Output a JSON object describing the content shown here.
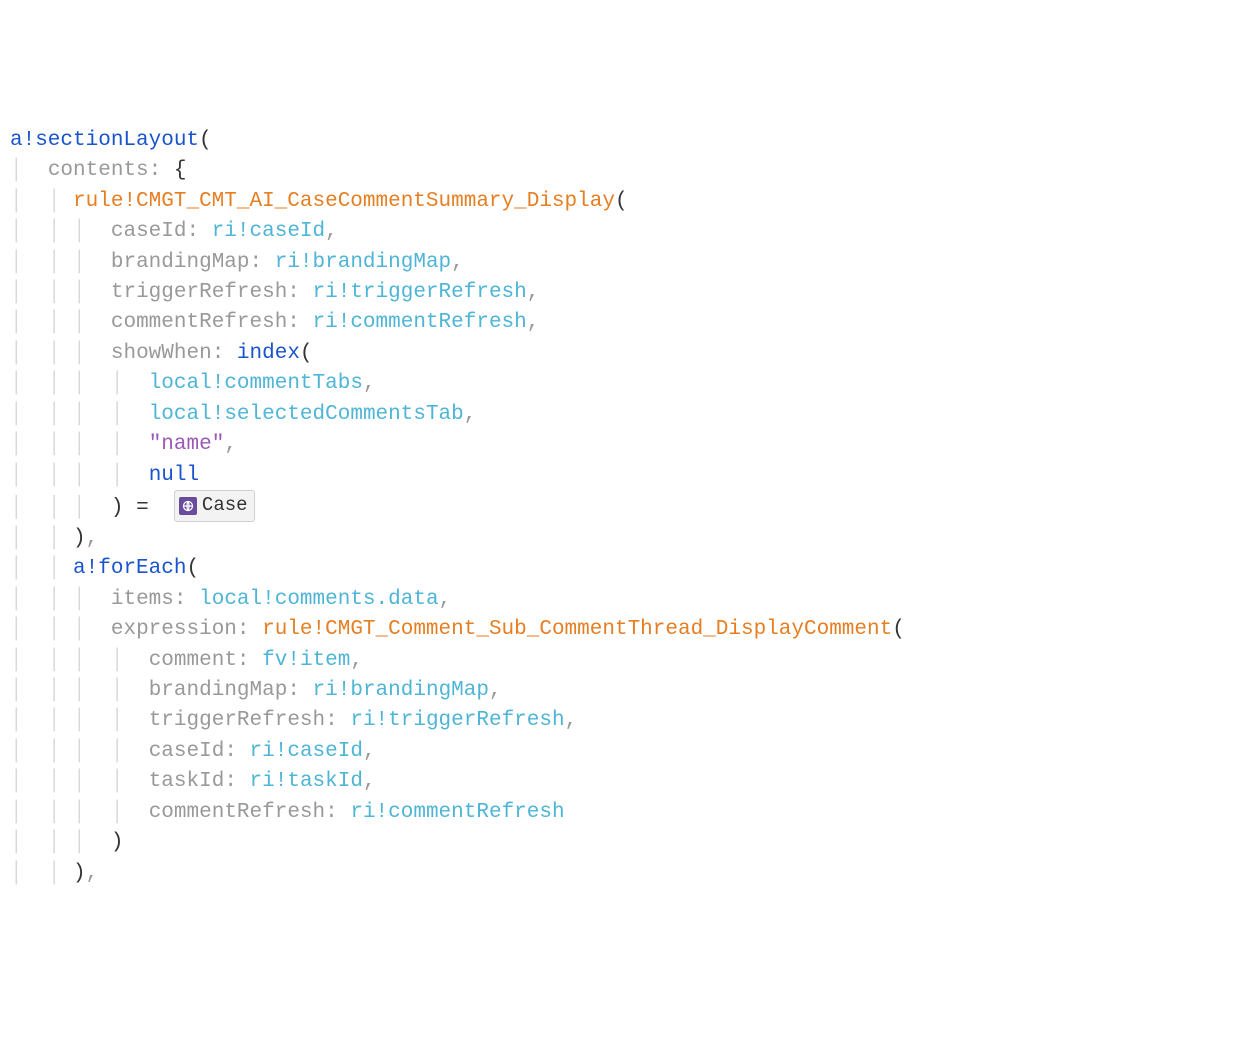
{
  "fn_sectionLayout": "a!sectionLayout",
  "fn_forEach": "a!forEach",
  "fn_index": "index",
  "rule_summary": "rule!CMGT_CMT_AI_CaseCommentSummary_Display",
  "rule_thread": "rule!CMGT_Comment_Sub_CommentThread_DisplayComment",
  "param_contents": "contents:",
  "param_caseId": "caseId:",
  "param_brandingMap": "brandingMap:",
  "param_triggerRefresh": "triggerRefresh:",
  "param_commentRefresh": "commentRefresh:",
  "param_showWhen": "showWhen:",
  "param_items": "items:",
  "param_expression": "expression:",
  "param_comment": "comment:",
  "param_taskId": "taskId:",
  "val_ri_caseId": "ri!caseId",
  "val_ri_brandingMap": "ri!brandingMap",
  "val_ri_triggerRefresh": "ri!triggerRefresh",
  "val_ri_commentRefresh": "ri!commentRefresh",
  "val_ri_taskId": "ri!taskId",
  "val_local_commentTabs": "local!commentTabs",
  "val_local_selectedCommentsTab": "local!selectedCommentsTab",
  "val_local_comments_data": "local!comments.data",
  "val_fv_item": "fv!item",
  "val_str_name": "\"name\"",
  "val_null": "null",
  "op_eq": "=",
  "punct_open_paren": "(",
  "punct_close_paren": ")",
  "punct_open_brace": "{",
  "punct_comma": ",",
  "chip_case": "Case",
  "guide": "│"
}
